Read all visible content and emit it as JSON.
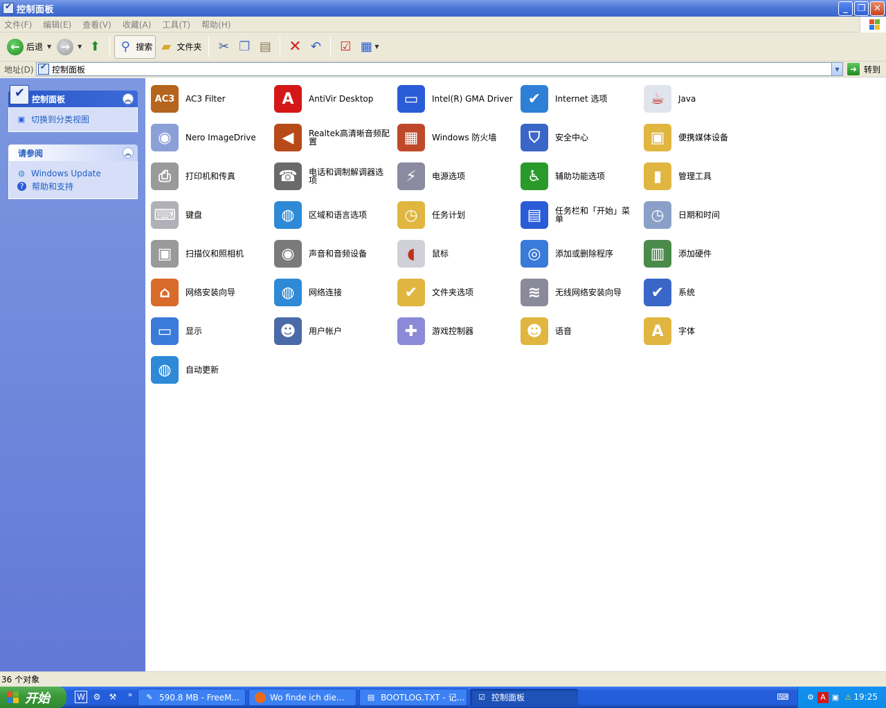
{
  "window": {
    "title": "控制面板",
    "buttons": {
      "minimize": "_",
      "maximize": "❐",
      "close": "✕"
    }
  },
  "menu": [
    "文件(F)",
    "编辑(E)",
    "查看(V)",
    "收藏(A)",
    "工具(T)",
    "帮助(H)"
  ],
  "toolbar": {
    "back": "后退",
    "search": "搜索",
    "folders": "文件夹"
  },
  "address": {
    "label": "地址(D)",
    "value": "控制面板",
    "go": "转到"
  },
  "sidebar": {
    "panel1": {
      "title": "控制面板",
      "link": "切换到分类视图"
    },
    "panel2": {
      "title": "请参阅",
      "links": [
        "Windows Update",
        "帮助和支持"
      ]
    }
  },
  "items": [
    {
      "label": "AC3 Filter",
      "icon": "ac3-filter-icon",
      "color": "#b5651d",
      "glyph": "AC3"
    },
    {
      "label": "AntiVir Desktop",
      "icon": "antivir-icon",
      "color": "#d41818",
      "glyph": "A"
    },
    {
      "label": "Intel(R) GMA Driver",
      "icon": "intel-gma-icon",
      "color": "#2a5cd8",
      "glyph": "▭"
    },
    {
      "label": "Internet 选项",
      "icon": "internet-options-icon",
      "color": "#2e7fd6",
      "glyph": "✔"
    },
    {
      "label": "Java",
      "icon": "java-icon",
      "color": "#e0e4ec",
      "glyph": "☕"
    },
    {
      "label": "Nero ImageDrive",
      "icon": "nero-imagedrive-icon",
      "color": "#8ca0d8",
      "glyph": "◉"
    },
    {
      "label": "Realtek高清晰音频配置",
      "icon": "realtek-audio-icon",
      "color": "#b84a1a",
      "glyph": "◀"
    },
    {
      "label": "Windows 防火墙",
      "icon": "firewall-icon",
      "color": "#c0482a",
      "glyph": "▦"
    },
    {
      "label": "安全中心",
      "icon": "security-center-icon",
      "color": "#3a66c8",
      "glyph": "⛉"
    },
    {
      "label": "便携媒体设备",
      "icon": "portable-media-icon",
      "color": "#e0b640",
      "glyph": "▣"
    },
    {
      "label": "打印机和传真",
      "icon": "printer-icon",
      "color": "#9a9a9a",
      "glyph": "⎙"
    },
    {
      "label": "电话和调制解调器选项",
      "icon": "phone-modem-icon",
      "color": "#6a6a6a",
      "glyph": "☎"
    },
    {
      "label": "电源选项",
      "icon": "power-options-icon",
      "color": "#8a8aa0",
      "glyph": "⚡"
    },
    {
      "label": "辅助功能选项",
      "icon": "accessibility-icon",
      "color": "#2a9a2a",
      "glyph": "♿"
    },
    {
      "label": "管理工具",
      "icon": "admin-tools-icon",
      "color": "#e0b640",
      "glyph": "▮"
    },
    {
      "label": "键盘",
      "icon": "keyboard-icon",
      "color": "#b0b0b8",
      "glyph": "⌨"
    },
    {
      "label": "区域和语言选项",
      "icon": "region-language-icon",
      "color": "#2e8ad6",
      "glyph": "◍"
    },
    {
      "label": "任务计划",
      "icon": "scheduled-tasks-icon",
      "color": "#e0b640",
      "glyph": "◷"
    },
    {
      "label": "任务栏和「开始」菜单",
      "icon": "taskbar-start-menu-icon",
      "color": "#2a5cd8",
      "glyph": "▤"
    },
    {
      "label": "日期和时间",
      "icon": "date-time-icon",
      "color": "#8aa0c8",
      "glyph": "◷"
    },
    {
      "label": "扫描仪和照相机",
      "icon": "scanner-camera-icon",
      "color": "#9a9a9a",
      "glyph": "▣"
    },
    {
      "label": "声音和音频设备",
      "icon": "sound-devices-icon",
      "color": "#7a7a7a",
      "glyph": "◉"
    },
    {
      "label": "鼠标",
      "icon": "mouse-icon",
      "color": "#d0d0d8",
      "glyph": "◖"
    },
    {
      "label": "添加或删除程序",
      "icon": "add-remove-programs-icon",
      "color": "#3a7ad8",
      "glyph": "◎"
    },
    {
      "label": "添加硬件",
      "icon": "add-hardware-icon",
      "color": "#4a8a4a",
      "glyph": "▥"
    },
    {
      "label": "网络安装向导",
      "icon": "network-setup-icon",
      "color": "#d86a2a",
      "glyph": "⌂"
    },
    {
      "label": "网络连接",
      "icon": "network-connections-icon",
      "color": "#2e8ad6",
      "glyph": "◍"
    },
    {
      "label": "文件夹选项",
      "icon": "folder-options-icon",
      "color": "#e0b640",
      "glyph": "✔"
    },
    {
      "label": "无线网络安装向导",
      "icon": "wireless-setup-icon",
      "color": "#8a8a9a",
      "glyph": "≋"
    },
    {
      "label": "系统",
      "icon": "system-icon",
      "color": "#3a66c8",
      "glyph": "✔"
    },
    {
      "label": "显示",
      "icon": "display-icon",
      "color": "#3a7ad8",
      "glyph": "▭"
    },
    {
      "label": "用户帐户",
      "icon": "user-accounts-icon",
      "color": "#4a6aa8",
      "glyph": "☻"
    },
    {
      "label": "游戏控制器",
      "icon": "game-controllers-icon",
      "color": "#8a8ad8",
      "glyph": "✚"
    },
    {
      "label": "语音",
      "icon": "speech-icon",
      "color": "#e0b640",
      "glyph": "☻"
    },
    {
      "label": "字体",
      "icon": "fonts-icon",
      "color": "#e0b640",
      "glyph": "A"
    },
    {
      "label": "自动更新",
      "icon": "automatic-updates-icon",
      "color": "#2e8ad6",
      "glyph": "◍"
    }
  ],
  "status": {
    "text": "36 个对象"
  },
  "taskbar": {
    "start": "开始",
    "tasks": [
      {
        "label": "590.8 MB - FreeM...",
        "icon": "freemind-icon"
      },
      {
        "label": "Wo finde ich die...",
        "icon": "firefox-icon"
      },
      {
        "label": "BOOTLOG.TXT - 记...",
        "icon": "notepad-icon"
      },
      {
        "label": "控制面板",
        "icon": "control-panel-icon"
      }
    ],
    "clock": "19:25"
  }
}
